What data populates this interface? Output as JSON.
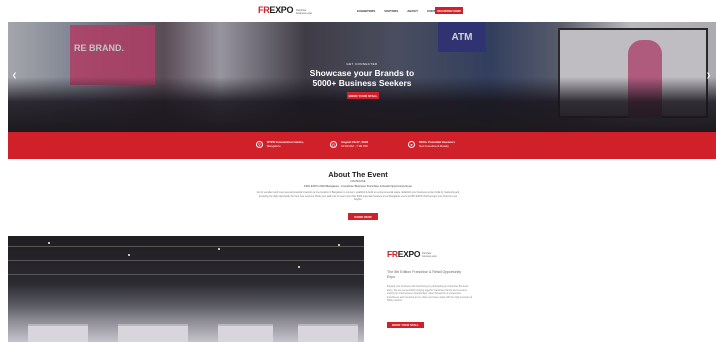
{
  "header": {
    "logo_fr": "FR",
    "logo_expo": "EXPO",
    "logo_sub": "franchise business expo",
    "nav": [
      "EXHIBITORS",
      "VISITORS",
      "ABOUT",
      "CONTACT US"
    ],
    "register_label": "REGISTER NOW"
  },
  "hero": {
    "tagline": "GET CONNECTED",
    "title_line1": "Showcase your Brands to",
    "title_line2": "5000+ Business Seekers",
    "cta_label": "BOOK YOUR STALL",
    "banner_text": "RE BRAND.",
    "atm_text": "ATM",
    "prev_icon": "chevron-left-icon",
    "next_icon": "chevron-right-icon"
  },
  "info": {
    "venue_title": "KTPO Convention Centre,",
    "venue_sub": "Bangalore",
    "date_title": "August 26-27, 2023",
    "date_sub": "10:00 AM - 7:00 PM",
    "audience_title": "5000+ Potential Investors",
    "audience_sub": "Get Investment Ready"
  },
  "about": {
    "title": "About The Event",
    "sub1": "FRANCHISE",
    "sub2": "FRO EXPO 2023 Bangalore  -  Franchise Business Franchise & Retail Opportunity Expo",
    "paragraph": "Go for excellent and meet several potential investors at one location in Bangalore to connect, establish & build an entrepreneurial space. Establish your business across India by marketing and providing the right opportunity for their new ventures. Book your stall now to meet more than 5000 potential investors at our Bangalore event at FRO EXPO 2023 and get your brand to new heights.",
    "cta_label": "BOOK NOW"
  },
  "feature": {
    "logo_fr": "FR",
    "logo_expo": "EXPO",
    "logo_sub": "franchise business expo",
    "heading": "The 5th Edition Franchise & Retail Opportunity Expo",
    "paragraph": "Expand your business with franchising by participating in Franchise Business Expo. We are successfully bringing together franchise brands and investors looking for real business opportunities. Meet thousands of prospective franchisees and investors at one place and close deals with the right investors at 5000+ visitors.",
    "cta_label": "BOOK YOUR STALL"
  },
  "colors": {
    "brand_red": "#d0202a",
    "text_dark": "#222222"
  }
}
